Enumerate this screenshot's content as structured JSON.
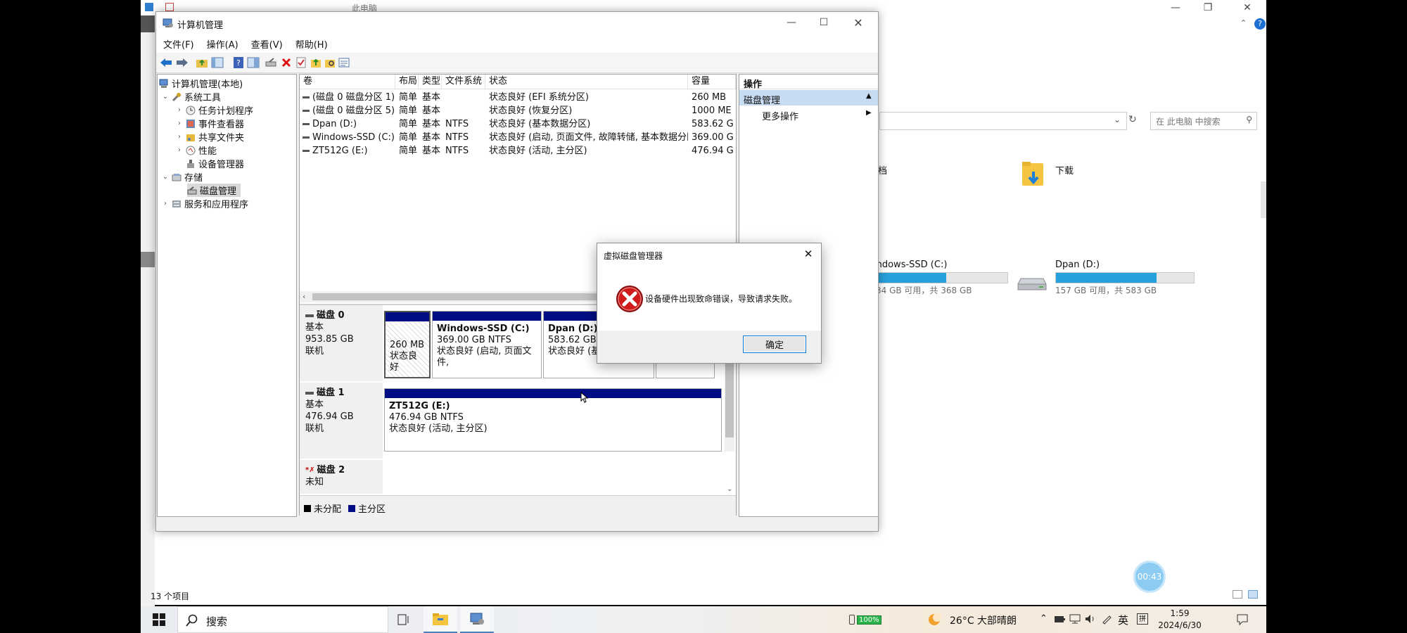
{
  "explorer": {
    "title": "此电脑",
    "search_placeholder": "在 此电脑 中搜索",
    "folders": [
      {
        "label": "档"
      },
      {
        "label": "下载"
      }
    ],
    "drives": [
      {
        "name": "indows-SSD (C:)",
        "free_text": "34 GB 可用，共 368 GB",
        "used_fraction": 0.53
      },
      {
        "name": "Dpan (D:)",
        "free_text": "157 GB 可用，共 583 GB",
        "used_fraction": 0.73
      }
    ],
    "status_count": "13 个项目"
  },
  "computer_management": {
    "title": "计算机管理",
    "menu": [
      "文件(F)",
      "操作(A)",
      "查看(V)",
      "帮助(H)"
    ],
    "tree": [
      {
        "label": "计算机管理(本地)"
      },
      {
        "label": "系统工具"
      },
      {
        "label": "任务计划程序"
      },
      {
        "label": "事件查看器"
      },
      {
        "label": "共享文件夹"
      },
      {
        "label": "性能"
      },
      {
        "label": "设备管理器"
      },
      {
        "label": "存储"
      },
      {
        "label": "磁盘管理"
      },
      {
        "label": "服务和应用程序"
      }
    ],
    "columns": [
      "卷",
      "布局",
      "类型",
      "文件系统",
      "状态",
      "容量"
    ],
    "volumes": [
      {
        "name": "(磁盘 0 磁盘分区 1)",
        "layout": "简单",
        "type": "基本",
        "fs": "",
        "status": "状态良好 (EFI 系统分区)",
        "capacity": "260 MB"
      },
      {
        "name": "(磁盘 0 磁盘分区 5)",
        "layout": "简单",
        "type": "基本",
        "fs": "",
        "status": "状态良好 (恢复分区)",
        "capacity": "1000 ME"
      },
      {
        "name": "Dpan (D:)",
        "layout": "简单",
        "type": "基本",
        "fs": "NTFS",
        "status": "状态良好 (基本数据分区)",
        "capacity": "583.62 G"
      },
      {
        "name": "Windows-SSD (C:)",
        "layout": "简单",
        "type": "基本",
        "fs": "NTFS",
        "status": "状态良好 (启动, 页面文件, 故障转储, 基本数据分区)",
        "capacity": "369.00 G"
      },
      {
        "name": "ZT512G (E:)",
        "layout": "简单",
        "type": "基本",
        "fs": "NTFS",
        "status": "状态良好 (活动, 主分区)",
        "capacity": "476.94 G"
      }
    ],
    "disks": [
      {
        "name": "磁盘 0",
        "kind": "基本",
        "size": "953.85 GB",
        "state": "联机"
      },
      {
        "name": "磁盘 1",
        "kind": "基本",
        "size": "476.94 GB",
        "state": "联机"
      },
      {
        "name": "磁盘 2",
        "kind": "未知",
        "size": "",
        "state": ""
      }
    ],
    "disk0_parts": [
      {
        "title": "",
        "line1": "260 MB",
        "line2": "状态良好"
      },
      {
        "title": "Windows-SSD  (C:)",
        "line1": "369.00 GB NTFS",
        "line2": "状态良好 (启动, 页面文件,"
      },
      {
        "title": "Dpan  (D:)",
        "line1": "583.62 GB N",
        "line2": "状态良好 (基"
      }
    ],
    "disk1_part": {
      "title": "ZT512G  (E:)",
      "line1": "476.94 GB NTFS",
      "line2": "状态良好 (活动, 主分区)"
    },
    "legend": [
      {
        "label": "未分配",
        "color": "#000000"
      },
      {
        "label": "主分区",
        "color": "#000d83"
      }
    ],
    "actions": {
      "header": "操作",
      "section": "磁盘管理",
      "more": "更多操作"
    }
  },
  "dialog": {
    "title": "虚拟磁盘管理器",
    "message": "设备硬件出现致命错误，导致请求失败。",
    "ok": "确定"
  },
  "taskbar": {
    "search": "搜索",
    "battery": "100%",
    "weather": "26°C  大部晴朗",
    "ime1": "英",
    "ime2": "拼",
    "time": "1:59",
    "date": "2024/6/30"
  },
  "recording_timer": "00:43"
}
